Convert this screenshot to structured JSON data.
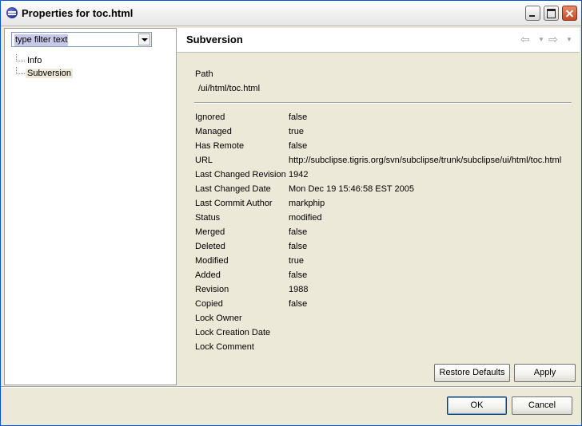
{
  "window": {
    "title": "Properties for toc.html"
  },
  "filter": {
    "placeholder": "type filter text",
    "value": "type filter text"
  },
  "tree": {
    "items": [
      {
        "label": "Info",
        "selected": false
      },
      {
        "label": "Subversion",
        "selected": true
      }
    ]
  },
  "page": {
    "title": "Subversion",
    "path_label": "Path",
    "path_value": "/ui/html/toc.html",
    "properties": [
      {
        "key": "Ignored",
        "value": "false"
      },
      {
        "key": "Managed",
        "value": "true"
      },
      {
        "key": "Has Remote",
        "value": "false"
      },
      {
        "key": "URL",
        "value": "http://subclipse.tigris.org/svn/subclipse/trunk/subclipse/ui/html/toc.html"
      },
      {
        "key": "Last Changed Revision",
        "value": "1942"
      },
      {
        "key": "Last Changed Date",
        "value": "Mon Dec 19 15:46:58 EST 2005"
      },
      {
        "key": "Last Commit Author",
        "value": "markphip"
      },
      {
        "key": "Status",
        "value": "modified"
      },
      {
        "key": "Merged",
        "value": "false"
      },
      {
        "key": "Deleted",
        "value": "false"
      },
      {
        "key": "Modified",
        "value": "true"
      },
      {
        "key": "Added",
        "value": "false"
      },
      {
        "key": "Revision",
        "value": "1988"
      },
      {
        "key": "Copied",
        "value": "false"
      },
      {
        "key": "Lock Owner",
        "value": ""
      },
      {
        "key": "Lock Creation Date",
        "value": ""
      },
      {
        "key": "Lock Comment",
        "value": ""
      }
    ],
    "restore_label": "Restore Defaults",
    "apply_label": "Apply"
  },
  "dialog": {
    "ok_label": "OK",
    "cancel_label": "Cancel"
  },
  "icons": {
    "app": "eclipse-icon",
    "back": "back-arrow-icon",
    "forward": "forward-arrow-icon",
    "dropdown": "chevron-down-icon"
  }
}
